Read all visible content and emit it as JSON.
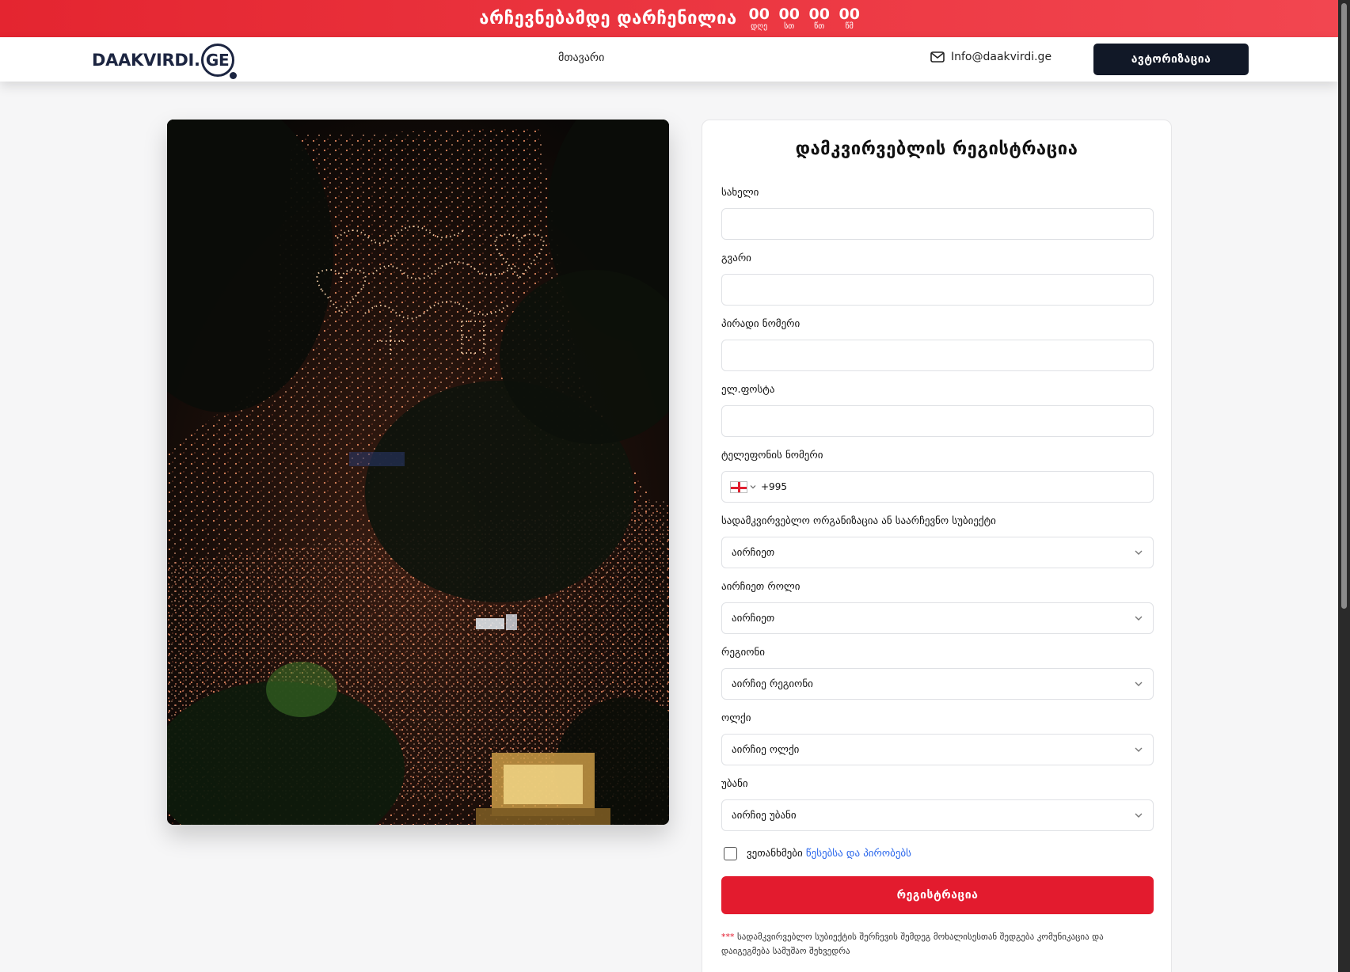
{
  "topbar": {
    "title": "არჩევნებამდე დარჩენილია",
    "countdown": [
      {
        "value": "00",
        "label": "დღე"
      },
      {
        "value": "00",
        "label": "სთ"
      },
      {
        "value": "00",
        "label": "წთ"
      },
      {
        "value": "00",
        "label": "წმ"
      }
    ]
  },
  "header": {
    "logo_text": "DAAKVIRDI.",
    "logo_suffix": "GE",
    "nav_home": "მთავარი",
    "email": "Info@daakvirdi.ge",
    "login_label": "ავტორიზაცია"
  },
  "form": {
    "title": "დამკვირვებლის რეგისტრაცია",
    "first_name_label": "სახელი",
    "last_name_label": "გვარი",
    "personal_id_label": "პირადი ნომერი",
    "email_label": "ელ.ფოსტა",
    "phone_label": "ტელეფონის ნომერი",
    "phone_code": "+995",
    "organization_label": "სადამკვირვებლო ორგანიზაცია ან საარჩევნო სუბიექტი",
    "organization_value": "აირჩიეთ",
    "role_label": "აირჩიეთ როლი",
    "role_value": "აირჩიეთ",
    "region_label": "რეგიონი",
    "region_value": "აირჩიე რეგიონი",
    "district_label": "ოლქი",
    "district_value": "აირჩიე ოლქი",
    "precinct_label": "უბანი",
    "precinct_value": "აირჩიე უბანი",
    "agree_text": "ვეთანხმები",
    "terms_link": "წესებსა და პირობებს",
    "submit_label": "რეგისტრაცია",
    "note_star": "***",
    "note_text": "სადამკვირვებლო სუბიექტის შერჩევის შემდეგ მოხალისესთან შედგება კომუნიკაცია და დაიგეგმება სამუშაო შეხვედრა"
  },
  "colors": {
    "accent_red": "#e31b2e",
    "dark_navy": "#111827",
    "link_blue": "#2563eb"
  }
}
